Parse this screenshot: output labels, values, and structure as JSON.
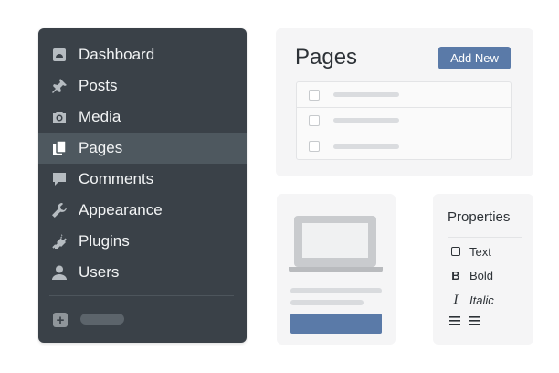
{
  "sidebar": {
    "items": [
      {
        "label": "Dashboard",
        "icon": "dashboard-icon"
      },
      {
        "label": "Posts",
        "icon": "pin-icon"
      },
      {
        "label": "Media",
        "icon": "camera-icon"
      },
      {
        "label": "Pages",
        "icon": "pages-icon",
        "active": true
      },
      {
        "label": "Comments",
        "icon": "comment-icon"
      },
      {
        "label": "Appearance",
        "icon": "wrench-icon"
      },
      {
        "label": "Plugins",
        "icon": "plug-icon"
      },
      {
        "label": "Users",
        "icon": "user-icon"
      }
    ],
    "collapse_icon": "plus-square-icon"
  },
  "pages_panel": {
    "title": "Pages",
    "add_new_label": "Add New",
    "row_count": 3
  },
  "preview": {
    "icon": "laptop-icon"
  },
  "properties": {
    "title": "Properties",
    "items": [
      {
        "label": "Text",
        "icon": "square-icon"
      },
      {
        "label": "Bold",
        "icon": "bold-icon",
        "glyph": "B"
      },
      {
        "label": "Italic",
        "icon": "italic-icon",
        "glyph": "I"
      },
      {
        "label": "",
        "icon": "list-icon"
      }
    ]
  },
  "colors": {
    "sidebar_bg": "#3a4148",
    "sidebar_active": "#4e585f",
    "accent": "#5a7aa8"
  }
}
